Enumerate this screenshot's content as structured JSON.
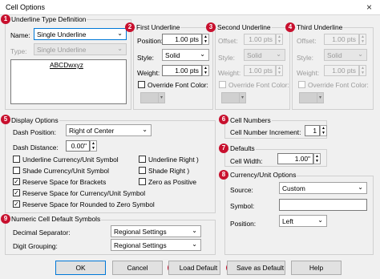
{
  "window": {
    "title": "Cell Options",
    "close": "×"
  },
  "badges": [
    "1",
    "2",
    "3",
    "4",
    "5",
    "6",
    "7",
    "8",
    "9",
    "10",
    "11"
  ],
  "underline_def": {
    "title": "Underline Type Definition",
    "name_label": "Name:",
    "name_value": "Single Underline",
    "type_label": "Type:",
    "type_value": "Single Underline",
    "preview": "ABCDwxyz"
  },
  "first_underline": {
    "title": "First Underline",
    "position_label": "Position:",
    "position_value": "1.00 pts",
    "style_label": "Style:",
    "style_value": "Solid",
    "weight_label": "Weight:",
    "weight_value": "1.00 pts",
    "override_label": "Override Font Color:"
  },
  "second_underline": {
    "title": "Second Underline",
    "offset_label": "Offset:",
    "offset_value": "1.00 pts",
    "style_label": "Style:",
    "style_value": "Solid",
    "weight_label": "Weight:",
    "weight_value": "1.00 pts",
    "override_label": "Override Font Color:"
  },
  "third_underline": {
    "title": "Third Underline",
    "offset_label": "Offset:",
    "offset_value": "1.00 pts",
    "style_label": "Style:",
    "style_value": "Solid",
    "weight_label": "Weight:",
    "weight_value": "1.00 pts",
    "override_label": "Override Font Color:"
  },
  "display_options": {
    "title": "Display Options",
    "dash_position_label": "Dash Position:",
    "dash_position_value": "Right of Center",
    "dash_distance_label": "Dash Distance:",
    "dash_distance_value": "0.00\"",
    "checks": [
      {
        "label": "Underline Currency/Unit Symbol",
        "checked": false
      },
      {
        "label": "Underline Right )",
        "checked": false
      },
      {
        "label": "Shade Currency/Unit Symbol",
        "checked": false
      },
      {
        "label": "Shade Right )",
        "checked": false
      },
      {
        "label": "Reserve Space for Brackets",
        "checked": true
      },
      {
        "label": "Zero as Positive",
        "checked": false
      },
      {
        "label": "Reserve Space for Currency/Unit Symbol",
        "checked": true
      },
      {
        "label": "Reserve Space for Rounded to Zero Symbol",
        "checked": true
      }
    ]
  },
  "cell_numbers": {
    "title": "Cell Numbers",
    "increment_label": "Cell Number Increment:",
    "increment_value": "1"
  },
  "defaults": {
    "title": "Defaults",
    "cell_width_label": "Cell Width:",
    "cell_width_value": "1.00\""
  },
  "currency": {
    "title": "Currency/Unit Options",
    "source_label": "Source:",
    "source_value": "Custom",
    "symbol_label": "Symbol:",
    "symbol_value": "",
    "position_label": "Position:",
    "position_value": "Left"
  },
  "numeric_defaults": {
    "title": "Numeric Cell Default Symbols",
    "decimal_label": "Decimal Separator:",
    "decimal_value": "Regional Settings",
    "digit_label": "Digit Grouping:",
    "digit_value": "Regional Settings"
  },
  "buttons": {
    "ok": "OK",
    "cancel": "Cancel",
    "load_default": "Load Default",
    "save_default": "Save as Default",
    "help": "Help"
  },
  "colors": {
    "badge": "#c8102e",
    "focus": "#0078d7"
  }
}
